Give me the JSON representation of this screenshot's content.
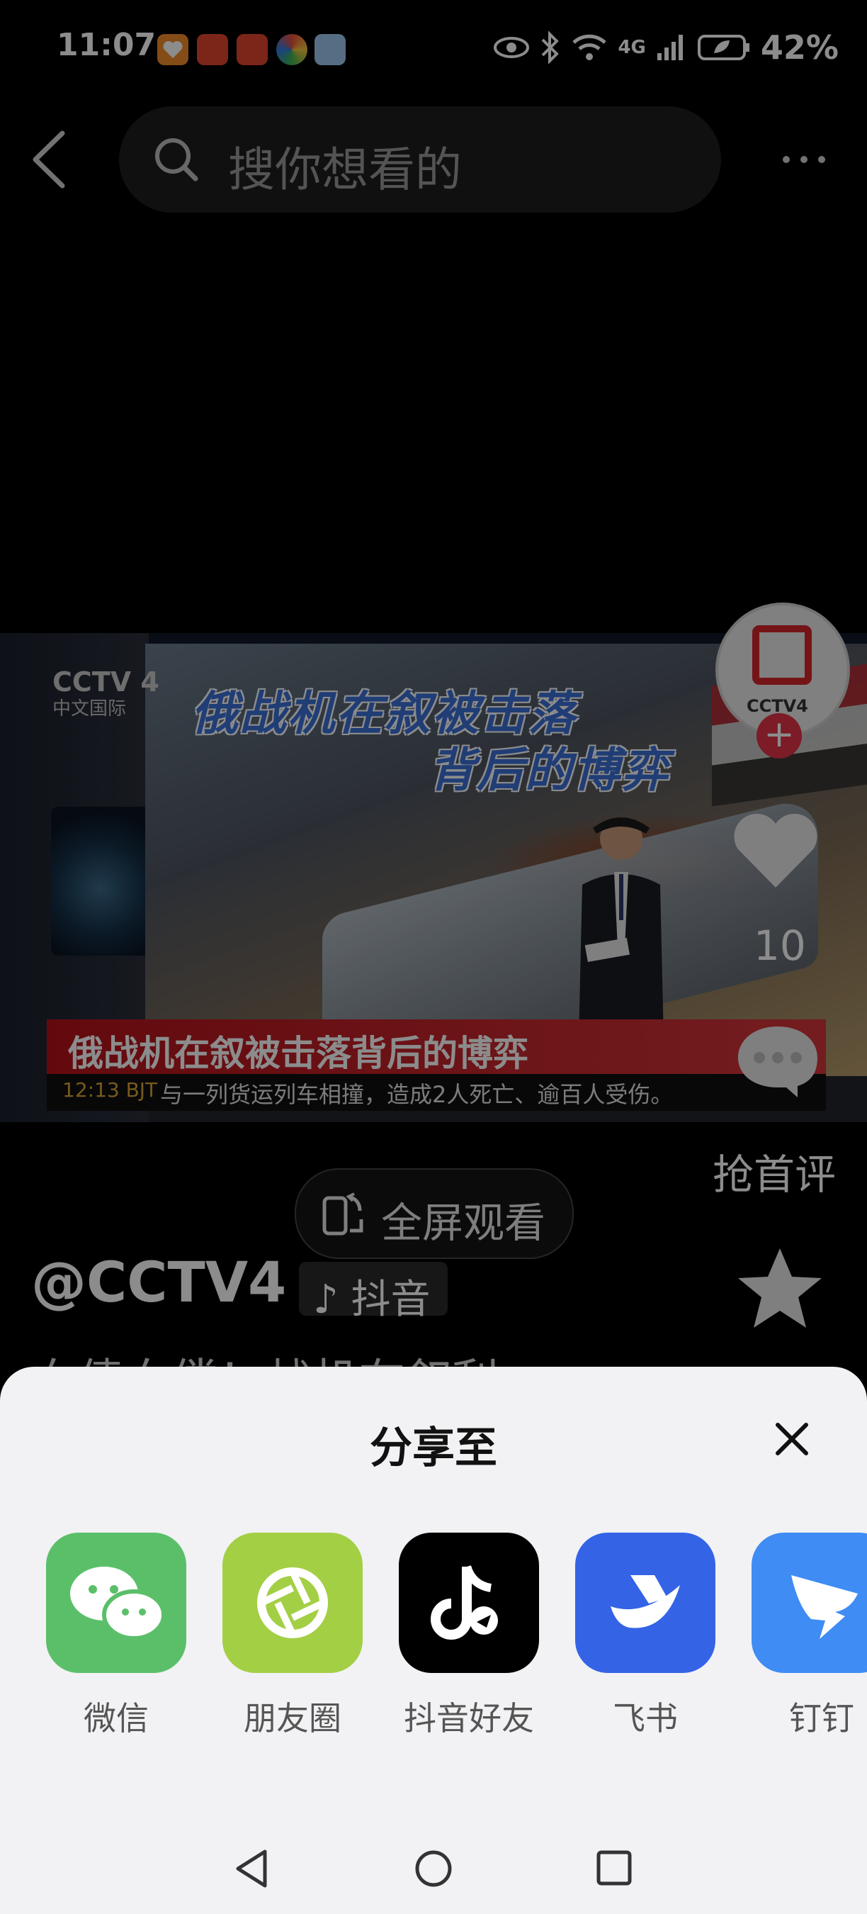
{
  "status_bar": {
    "time": "11:07",
    "battery": "42%",
    "network": "4G",
    "app_icons": [
      "app-orange-heart-icon",
      "app-red-calendar-icon",
      "app-red-calendar-icon-2",
      "app-colorful-circle-icon",
      "app-game-icon"
    ]
  },
  "header": {
    "search_placeholder": "搜你想看的"
  },
  "video": {
    "screen_title_line1": "俄战机在叙被击落",
    "screen_title_line2": "背后的博弈",
    "channel_logo": "CCTV 4",
    "channel_sub": "中文国际",
    "lower_third": "俄战机在叙被击落背后的博弈",
    "ticker_time": "12:13 BJT",
    "ticker_text": "与一列货运列车相撞，造成2人死亡、逾百人受伤。"
  },
  "side_actions": {
    "avatar_label": "CCTV4",
    "follow_label": "+",
    "like_count": "10",
    "comment_label": "抢首评"
  },
  "fullscreen_button": "全屏观看",
  "author": "@CCTV4",
  "author_tag": "抖音",
  "description": "血债血偿！战机在叙利",
  "share_sheet": {
    "title": "分享至",
    "items": [
      {
        "label": "微信",
        "color": "#5bbf6a"
      },
      {
        "label": "朋友圈",
        "color": "#a3cf45"
      },
      {
        "label": "抖音好友",
        "color": "#000000"
      },
      {
        "label": "飞书",
        "color": "#3463e6"
      },
      {
        "label": "钉钉",
        "color": "#3f8cf4"
      }
    ]
  }
}
